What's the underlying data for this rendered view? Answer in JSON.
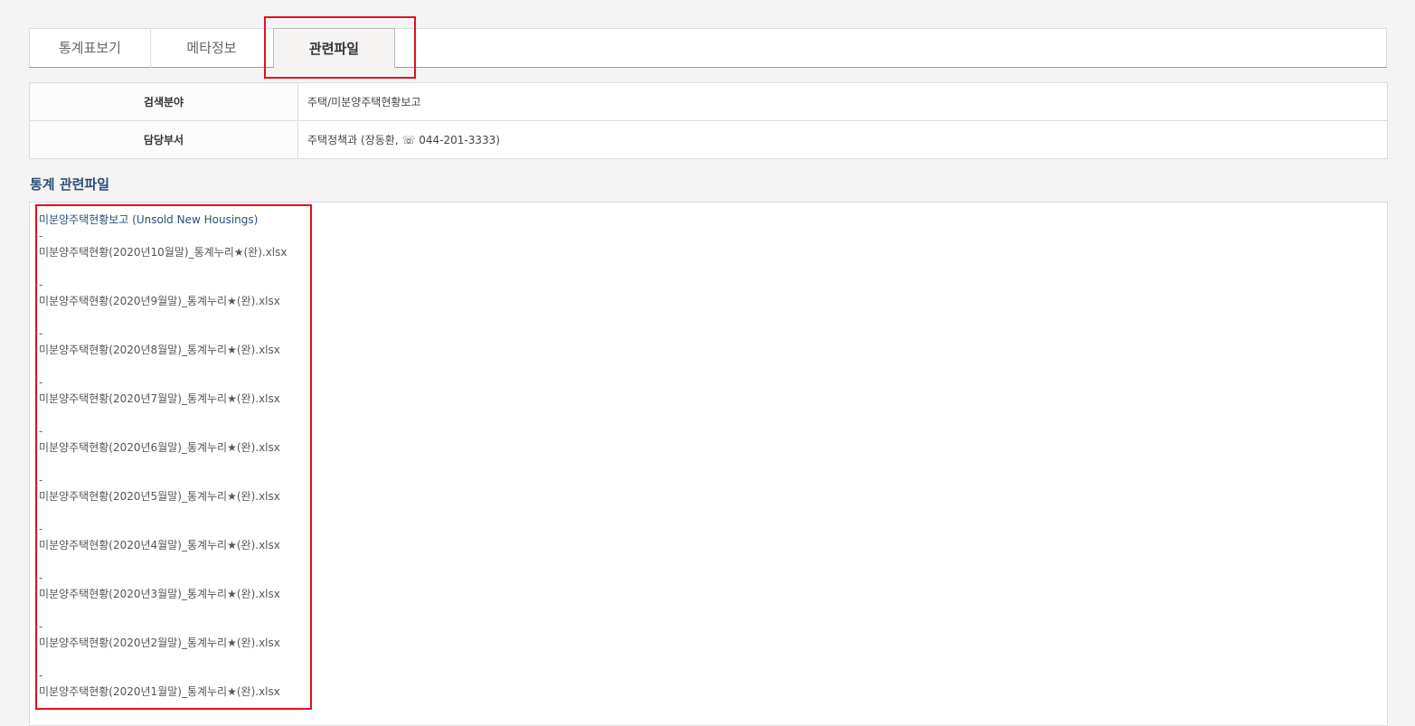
{
  "tabs": [
    {
      "label": "통계표보기"
    },
    {
      "label": "메타정보"
    },
    {
      "label": "관련파일"
    }
  ],
  "info": {
    "search_field": {
      "label": "검색분야",
      "value": "주택/미분양주택현황보고"
    },
    "department": {
      "label": "담당부서",
      "value": "주택정책과 (장동환, ☏ 044-201-3333)"
    }
  },
  "section": {
    "title": "통계 관련파일"
  },
  "files": {
    "header": "미분양주택현황보고 (Unsold New Housings)",
    "dash": "-",
    "items": [
      {
        "name": "미분양주택현황(2020년10월말)_통계누리★(완).xlsx"
      },
      {
        "name": "미분양주택현황(2020년9월말)_통계누리★(완).xlsx"
      },
      {
        "name": "미분양주택현황(2020년8월말)_통계누리★(완).xlsx"
      },
      {
        "name": "미분양주택현황(2020년7월말)_통계누리★(완).xlsx"
      },
      {
        "name": "미분양주택현황(2020년6월말)_통계누리★(완).xlsx"
      },
      {
        "name": "미분양주택현황(2020년5월말)_통계누리★(완).xlsx"
      },
      {
        "name": "미분양주택현황(2020년4월말)_통계누리★(완).xlsx"
      },
      {
        "name": "미분양주택현황(2020년3월말)_통계누리★(완).xlsx"
      },
      {
        "name": "미분양주택현황(2020년2월말)_통계누리★(완).xlsx"
      },
      {
        "name": "미분양주택현황(2020년1월말)_통계누리★(완).xlsx"
      }
    ]
  },
  "colors": {
    "highlight": "#e3101c",
    "title": "#2a4f7c"
  }
}
